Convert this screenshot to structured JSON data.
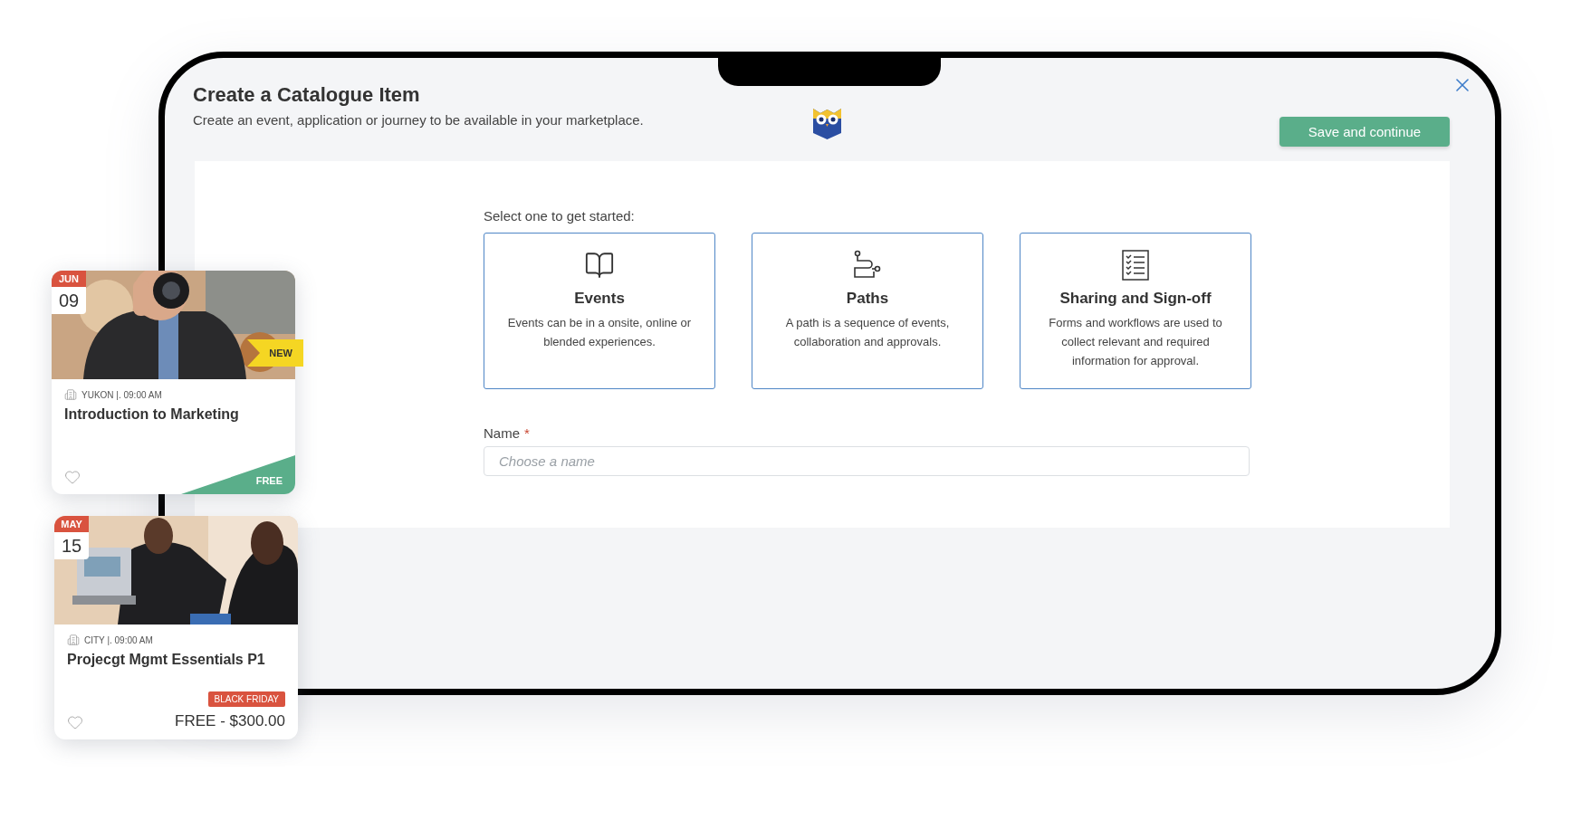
{
  "dialog": {
    "title": "Create a Catalogue Item",
    "subtitle": "Create an event, application or journey to be available in your marketplace.",
    "save_button": "Save and continue"
  },
  "prompt": "Select one to get started:",
  "options": [
    {
      "kind": "events",
      "title": "Events",
      "description": "Events can be in a onsite, online or blended experiences.",
      "selected": false
    },
    {
      "kind": "paths",
      "title": "Paths",
      "description": "A path is a sequence of events, collaboration and approvals.",
      "selected": false
    },
    {
      "kind": "signoff",
      "title": "Sharing and Sign-off",
      "description": "Forms and workflows are used to collect relevant and required information for approval.",
      "selected": false
    }
  ],
  "name_field": {
    "label": "Name",
    "required_mark": "*",
    "placeholder": "Choose a name"
  },
  "event_cards": [
    {
      "kind": "corner",
      "month": "JUN",
      "day": "09",
      "location": "YUKON |. 09:00 AM",
      "title": "Introduction to Marketing",
      "ribbon": "NEW",
      "price": "FREE"
    },
    {
      "kind": "plain",
      "month": "MAY",
      "day": "15",
      "location": "CITY |. 09:00 AM",
      "title": "Projecgt Mgmt Essentials P1",
      "tag": "BLACK FRIDAY",
      "price": "FREE - $300.00"
    }
  ]
}
